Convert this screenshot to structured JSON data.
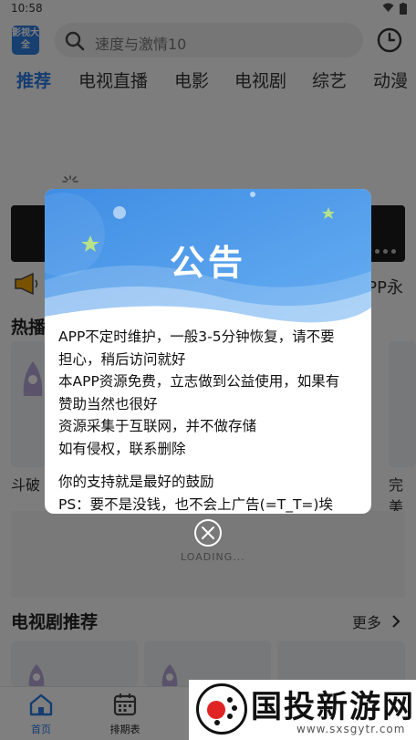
{
  "status_bar": {
    "time": "10:58"
  },
  "header": {
    "logo_text": "影视大全",
    "search_placeholder": "速度与激情10"
  },
  "tabs": [
    {
      "label": "推荐",
      "active": true
    },
    {
      "label": "电视直播",
      "active": false
    },
    {
      "label": "电影",
      "active": false
    },
    {
      "label": "电视剧",
      "active": false
    },
    {
      "label": "综艺",
      "active": false
    },
    {
      "label": "动漫",
      "active": false
    }
  ],
  "background": {
    "notice_partial": "PP永",
    "hot_section_partial": "热播",
    "card_left_partial": "斗破",
    "card_right_partial": "完美",
    "loading_text": "LOADING...",
    "tv_section_title": "电视剧推荐",
    "more_label": "更多"
  },
  "bottom_nav": [
    {
      "label": "首页",
      "icon": "home-icon",
      "active": true
    },
    {
      "label": "排期表",
      "icon": "calendar-icon",
      "active": false
    }
  ],
  "dialog": {
    "title": "公告",
    "lines": [
      "APP不定时维护，一般3-5分钟恢复，请不要",
      "担心，稍后访问就好",
      "本APP资源免费，立志做到公益使用，如果有",
      "赞助当然也很好",
      "资源采集于互联网，并不做存储",
      "如有侵权，联系删除",
      "",
      "你的支持就是最好的鼓励",
      "PS：要不是没钱，也不会上广告(=T_T=)埃"
    ]
  },
  "watermark": {
    "text": "国投新游网",
    "url": "www.sxsgytr.com"
  },
  "colors": {
    "accent": "#2a7ae2",
    "dialog_header": "#4a90e2"
  }
}
